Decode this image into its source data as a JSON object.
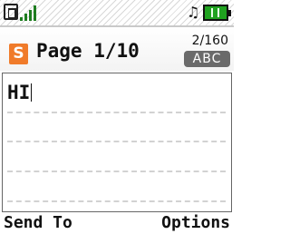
{
  "status_bar": {
    "icons": [
      "signal-box-icon",
      "signal-strength-icon",
      "music-note-icon",
      "battery-icon"
    ],
    "colors": {
      "signal": "#1e7d20",
      "battery": "#1fa21f"
    }
  },
  "header": {
    "app_icon_letter": "S",
    "title": "Page 1/10",
    "char_counter": "2/160",
    "input_mode": "ABC",
    "colors": {
      "app_icon": "#f07b2a",
      "mode_badge": "#6a6a6a"
    }
  },
  "editor": {
    "text": "HI"
  },
  "softkeys": {
    "left": "Send To",
    "right": "Options"
  }
}
